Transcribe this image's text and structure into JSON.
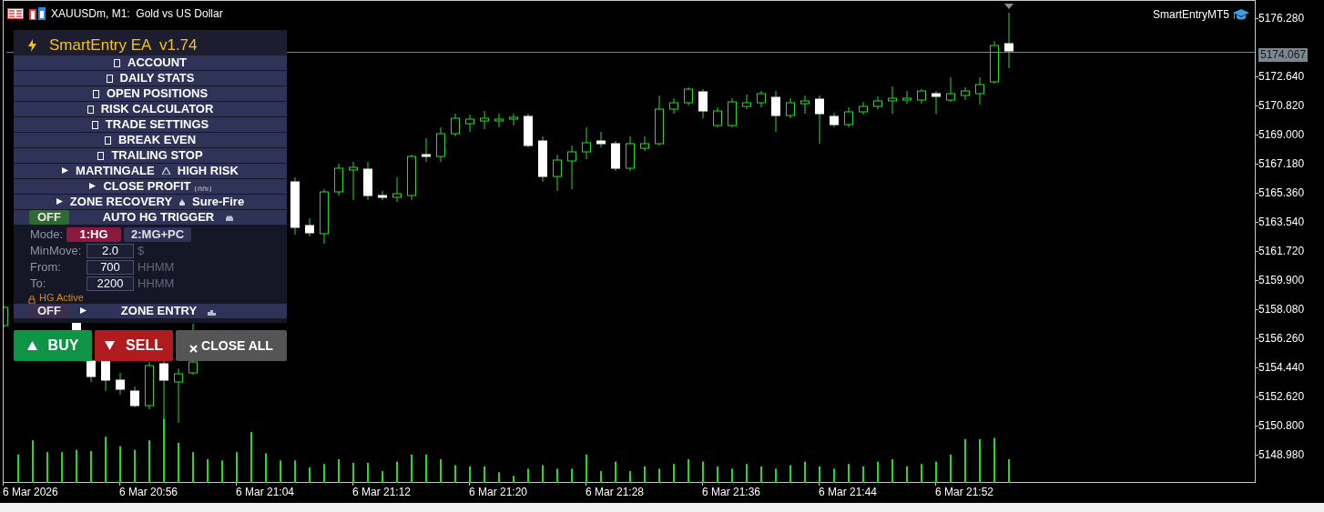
{
  "window": {
    "title": "XAUUSDm, M1:  Gold vs US Dollar",
    "expert_label": "SmartEntryMT5"
  },
  "panel": {
    "title": "SmartEntry EA  v1.74",
    "sections": [
      {
        "kind": "menu",
        "label": "ACCOUNT"
      },
      {
        "kind": "menu",
        "label": "DAILY STATS"
      },
      {
        "kind": "menu",
        "label": "OPEN POSITIONS"
      },
      {
        "kind": "menu",
        "label": "RISK CALCULATOR"
      },
      {
        "kind": "menu",
        "label": "TRADE SETTINGS"
      },
      {
        "kind": "menu",
        "label": "BREAK EVEN"
      },
      {
        "kind": "menu",
        "label": "TRAILING STOP"
      },
      {
        "kind": "toggle",
        "label": "MARTINGALE",
        "tag": {
          "kind": "warning",
          "text": "HIGH RISK"
        }
      },
      {
        "kind": "toggle",
        "label": "CLOSE PROFIT"
      },
      {
        "kind": "toggle",
        "label": "ZONE RECOVERY",
        "tag": {
          "kind": "drop",
          "text": "Sure-Fire"
        }
      },
      {
        "kind": "switch",
        "switch": "OFF",
        "on": false,
        "label": "AUTO HG TRIGGER"
      }
    ],
    "hg_settings": {
      "mode_label": "Mode:",
      "modes": [
        {
          "label": "1:HG",
          "selected": true
        },
        {
          "label": "2:MG+PC",
          "selected": false
        }
      ],
      "fields": [
        {
          "label": "MinMove:",
          "value": "2.0",
          "unit": "$"
        },
        {
          "label": "From:",
          "value": "700",
          "unit": "HHMM"
        },
        {
          "label": "To:",
          "value": "2200",
          "unit": "HHMM"
        }
      ],
      "status": "HG Active"
    },
    "zone_entry": {
      "switch": "OFF",
      "on": false,
      "label": "ZONE ENTRY"
    }
  },
  "trade_buttons": [
    {
      "kind": "buy",
      "label": "BUY"
    },
    {
      "kind": "sell",
      "label": "SELL"
    },
    {
      "kind": "close",
      "label": "CLOSE ALL"
    }
  ],
  "price_axis": {
    "labels": [
      "5176.280",
      "5172.640",
      "5170.820",
      "5169.000",
      "5167.180",
      "5165.360",
      "5163.540",
      "5161.720",
      "5159.900",
      "5158.080",
      "5156.260",
      "5154.440",
      "5152.620",
      "5150.800",
      "5148.980"
    ],
    "current_price": "5174.067"
  },
  "time_axis": {
    "labels": [
      "6 Mar 2026",
      "6 Mar 20:56",
      "6 Mar 21:04",
      "6 Mar 21:12",
      "6 Mar 21:20",
      "6 Mar 21:28",
      "6 Mar 21:36",
      "6 Mar 21:44",
      "6 Mar 21:52"
    ]
  }
}
